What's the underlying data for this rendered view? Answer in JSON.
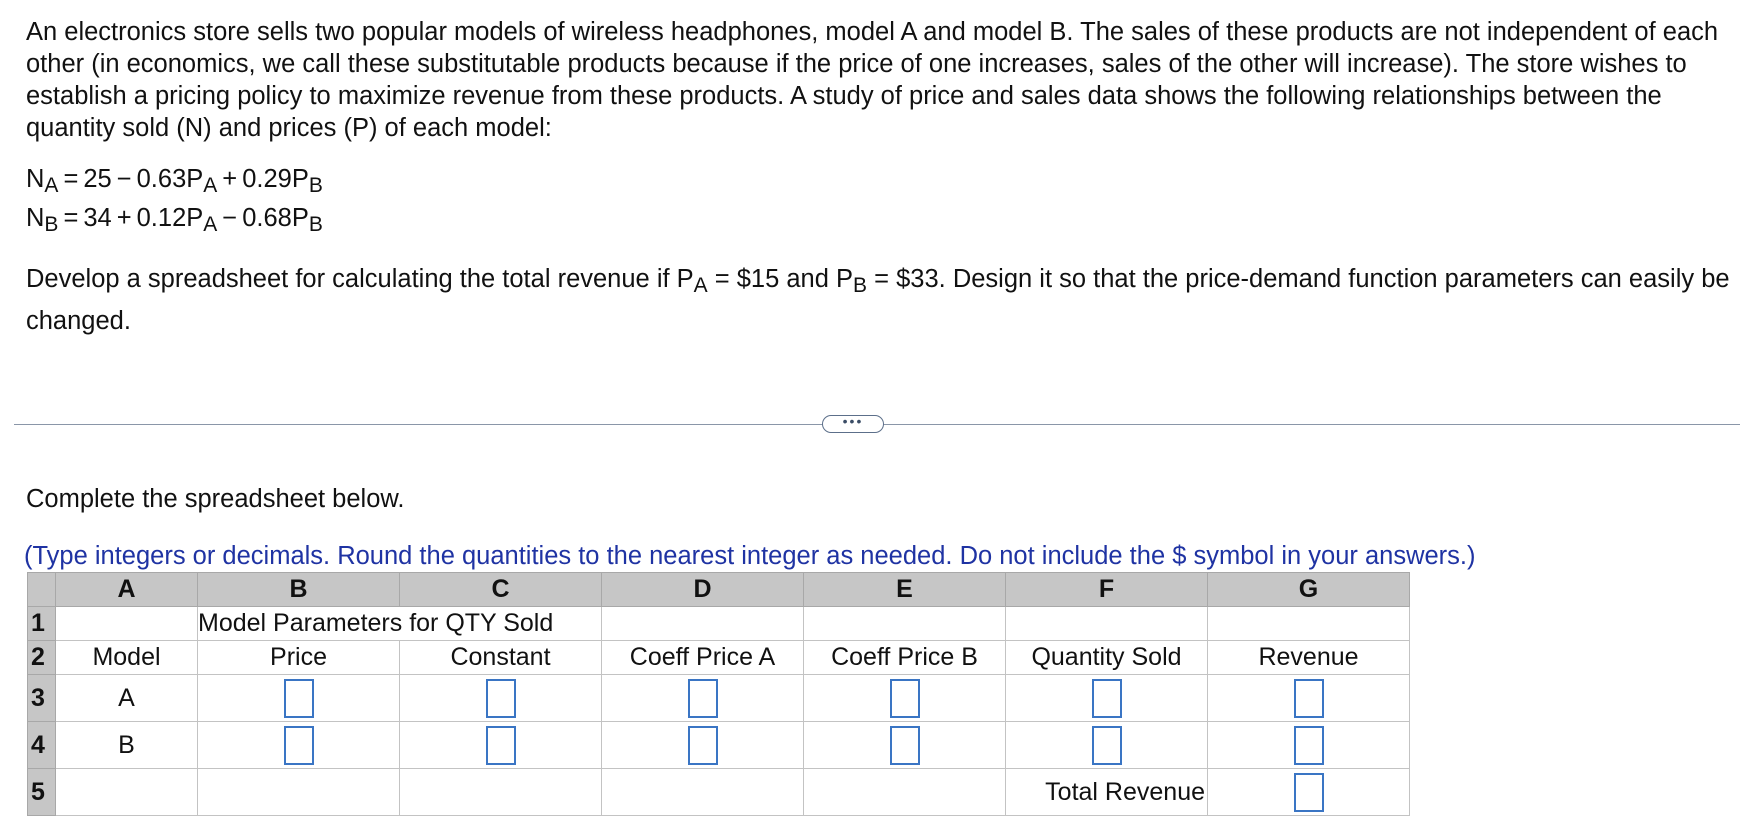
{
  "intro_text": "An electronics store sells two popular models of wireless headphones, model A and model B. The sales of these products are not independent of each other (in economics, we call these substitutable products because if the price of one increases, sales of the other will increase). The store wishes to establish a pricing policy to maximize revenue from these products. A study of price and sales data shows the following relationships between the quantity sold (N) and prices (P) of each model:",
  "equations": {
    "a": {
      "lhs": "N",
      "lhs_sub": "A",
      "eq": "=",
      "constant": "25",
      "op1": "−",
      "coef1": "0.63P",
      "sub1": "A",
      "op2": "+",
      "coef2": "0.29P",
      "sub2": "B"
    },
    "b": {
      "lhs": "N",
      "lhs_sub": "B",
      "eq": "=",
      "constant": "34",
      "op1": "+",
      "coef1": "0.12P",
      "sub1": "A",
      "op2": "−",
      "coef2": "0.68P",
      "sub2": "B"
    }
  },
  "develop": {
    "part1": "Develop a spreadsheet for calculating the total revenue if P",
    "sub_a": "A",
    "part2": " = $15 and P",
    "sub_b": "B",
    "part3": " = $33. Design it so that the price-demand function parameters can easily be changed."
  },
  "more_button_label": "•••",
  "complete_text": "Complete the spreadsheet below.",
  "instructions": "(Type integers or decimals. Round the quantities to the nearest integer as needed. Do not include the $ symbol in your answers.)",
  "sheet": {
    "columns": [
      "A",
      "B",
      "C",
      "D",
      "E",
      "F",
      "G"
    ],
    "row_numbers": [
      "1",
      "2",
      "3",
      "4",
      "5"
    ],
    "row1_title": "Model Parameters for QTY Sold",
    "row2_headers": [
      "Model",
      "Price",
      "Constant",
      "Coeff Price A",
      "Coeff Price B",
      "Quantity Sold",
      "Revenue"
    ],
    "models": [
      "A",
      "B"
    ],
    "total_revenue_label": "Total Revenue"
  }
}
